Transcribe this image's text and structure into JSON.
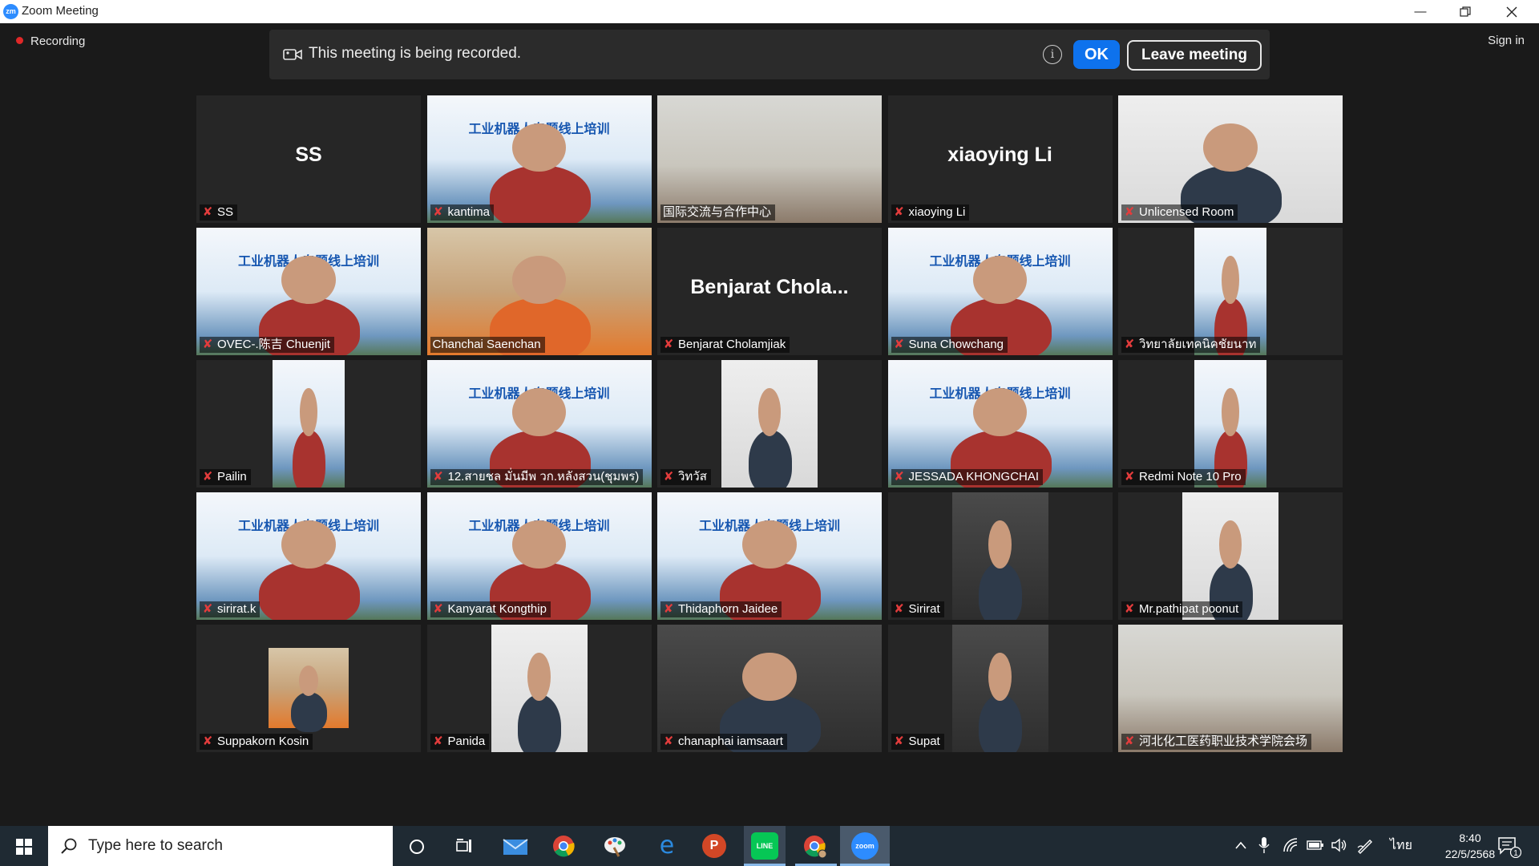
{
  "window": {
    "app_icon": "zm",
    "title": "Zoom Meeting",
    "controls": [
      "minimize-icon",
      "restore-icon",
      "close-icon"
    ]
  },
  "meeting": {
    "recording_label": "Recording",
    "sign_in_label": "Sign in",
    "banner": {
      "message": "This meeting is being recorded.",
      "info_glyph": "i",
      "ok_label": "OK",
      "leave_label": "Leave meeting"
    }
  },
  "participants": [
    {
      "name": "SS",
      "display": "SS",
      "video": false,
      "muted": true
    },
    {
      "name": "kantima",
      "video": true,
      "muted": true,
      "bg": "slide"
    },
    {
      "name": "国际交流与合作中心",
      "video": true,
      "muted": false,
      "bg": "room"
    },
    {
      "name": "xiaoying Li",
      "display": "xiaoying Li",
      "video": false,
      "muted": true
    },
    {
      "name": "Unlicensed Room",
      "video": true,
      "muted": true,
      "bg": "wall"
    },
    {
      "name": "OVEC-.陈吉 Chuenjit",
      "video": true,
      "muted": true,
      "bg": "slide"
    },
    {
      "name": "Chanchai Saenchan",
      "video": true,
      "muted": false,
      "bg": "red",
      "active_speaker": true
    },
    {
      "name": "Benjarat Cholamjiak",
      "display": "Benjarat  Chola...",
      "video": false,
      "muted": true
    },
    {
      "name": "Suna Chowchang",
      "video": true,
      "muted": true,
      "bg": "slide"
    },
    {
      "name": "วิทยาลัยเทคนิคชัยนาท",
      "video": true,
      "muted": true,
      "bg": "slide-narrow"
    },
    {
      "name": "Pailin",
      "video": true,
      "muted": true,
      "bg": "slide-narrow"
    },
    {
      "name": "12.สายชล มั่นมีพ วก.หลังสวน(ชุมพร)",
      "video": true,
      "muted": true,
      "bg": "slide"
    },
    {
      "name": "วิทวัส",
      "video": true,
      "muted": true,
      "bg": "wall-narrow"
    },
    {
      "name": "JESSADA  KHONGCHAI",
      "video": true,
      "muted": true,
      "bg": "slide"
    },
    {
      "name": "Redmi Note 10 Pro",
      "video": true,
      "muted": true,
      "bg": "slide-narrow"
    },
    {
      "name": "sirirat.k",
      "video": true,
      "muted": true,
      "bg": "slide"
    },
    {
      "name": "Kanyarat Kongthip",
      "video": true,
      "muted": true,
      "bg": "slide"
    },
    {
      "name": "Thidaphorn Jaidee",
      "video": true,
      "muted": true,
      "bg": "slide"
    },
    {
      "name": "Sirirat",
      "video": true,
      "muted": true,
      "bg": "dark-narrow"
    },
    {
      "name": "Mr.pathipat poonut",
      "video": true,
      "muted": true,
      "bg": "wall-narrow"
    },
    {
      "name": "Suppakorn Kosin",
      "video": true,
      "muted": true,
      "bg": "small"
    },
    {
      "name": "Panida",
      "video": true,
      "muted": true,
      "bg": "wall-narrow"
    },
    {
      "name": "chanaphai iamsaart",
      "video": true,
      "muted": true,
      "bg": "dark"
    },
    {
      "name": "Supat",
      "video": true,
      "muted": true,
      "bg": "dark-narrow"
    },
    {
      "name": "河北化工医药职业技术学院会场",
      "video": true,
      "muted": true,
      "bg": "room"
    }
  ],
  "slide_text": "工业机器人专题线上培训",
  "taskbar": {
    "search_placeholder": "Type here to search",
    "apps": [
      "cortana-icon",
      "task-view-icon",
      "mail-icon",
      "chrome-icon",
      "paint-icon",
      "edge-icon",
      "powerpoint-icon",
      "line-icon",
      "chrome-profile-icon",
      "zoom-icon"
    ],
    "app_glyphs": {
      "powerpoint": "P",
      "line": "LINE",
      "zoom": "zoom",
      "edge": "e"
    },
    "language": "ไทย",
    "time": "8:40",
    "date": "22/5/2568",
    "notification_count": "1"
  }
}
